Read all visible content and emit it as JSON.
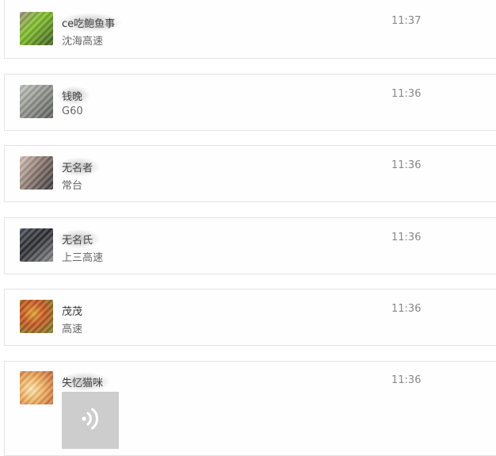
{
  "messages": [
    {
      "name": "ce吃鲍鱼事",
      "text": "沈海高速",
      "time": "11:37",
      "avatar": "avatar-photo",
      "colors": [
        "#7fbf2a",
        "#3d5a1e",
        "#9a8f7a"
      ]
    },
    {
      "name": "钱晚",
      "text": "G60",
      "time": "11:36",
      "avatar": "avatar-photo",
      "colors": [
        "#8c8f88",
        "#c2c4be",
        "#5a5c57"
      ]
    },
    {
      "name": "无名者",
      "text": "常台",
      "time": "11:36",
      "avatar": "avatar-photo",
      "colors": [
        "#d8c2b6",
        "#7c6b63",
        "#3a3a40"
      ]
    },
    {
      "name": "无名氏",
      "text": "上三高速",
      "time": "11:36",
      "avatar": "avatar-photo",
      "colors": [
        "#2b2b30",
        "#8a8c90",
        "#4a5058"
      ]
    },
    {
      "name": "茂茂",
      "text": "高速",
      "time": "11:36",
      "avatar": "avatar-photo",
      "colors": [
        "#c5531c",
        "#6f7f2a",
        "#e0a030"
      ]
    },
    {
      "name": "失忆猫咪",
      "text": "",
      "time": "11:36",
      "avatar": "avatar-photo",
      "colors": [
        "#f0b060",
        "#c06030",
        "#fde6b0"
      ],
      "voice_icon": "voice-wave-icon"
    }
  ]
}
